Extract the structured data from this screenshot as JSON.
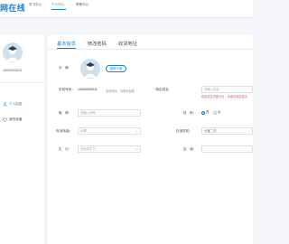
{
  "header": {
    "logo": "网在线",
    "nav": [
      {
        "label": "学习中心"
      },
      {
        "label": "个人中心"
      },
      {
        "label": "帮助中心"
      }
    ]
  },
  "sidebar": {
    "phone": "15000000011",
    "items": [
      {
        "label": "个人信息"
      },
      {
        "label": "我的收藏"
      }
    ]
  },
  "tabs": [
    {
      "label": "基本信息"
    },
    {
      "label": "修改密码"
    },
    {
      "label": "收货地址"
    }
  ],
  "form": {
    "avatar_label": "头　像：",
    "change_avatar": "更换头像",
    "phone_label": "手机号码：",
    "phone_value": "15000000011",
    "phone_hint": "若需修改，请联系客服",
    "real_name_label": "真实姓名：",
    "real_name_placeholder": "请输入姓名",
    "real_name_error": "真实姓名不能为空，请填写真实姓名",
    "nickname_label": "昵　称：",
    "nickname_placeholder": "请输入昵称",
    "gender_label": "性　别：",
    "gender_options": [
      "男",
      "女"
    ],
    "grade_label": "在读年级：",
    "grade_value": "小学",
    "school_label": "在读学校：",
    "school_value": "七宝二中",
    "birthday_label": "生　日：",
    "birthday_placeholder": "请选择生日",
    "region_label": "区　域："
  }
}
